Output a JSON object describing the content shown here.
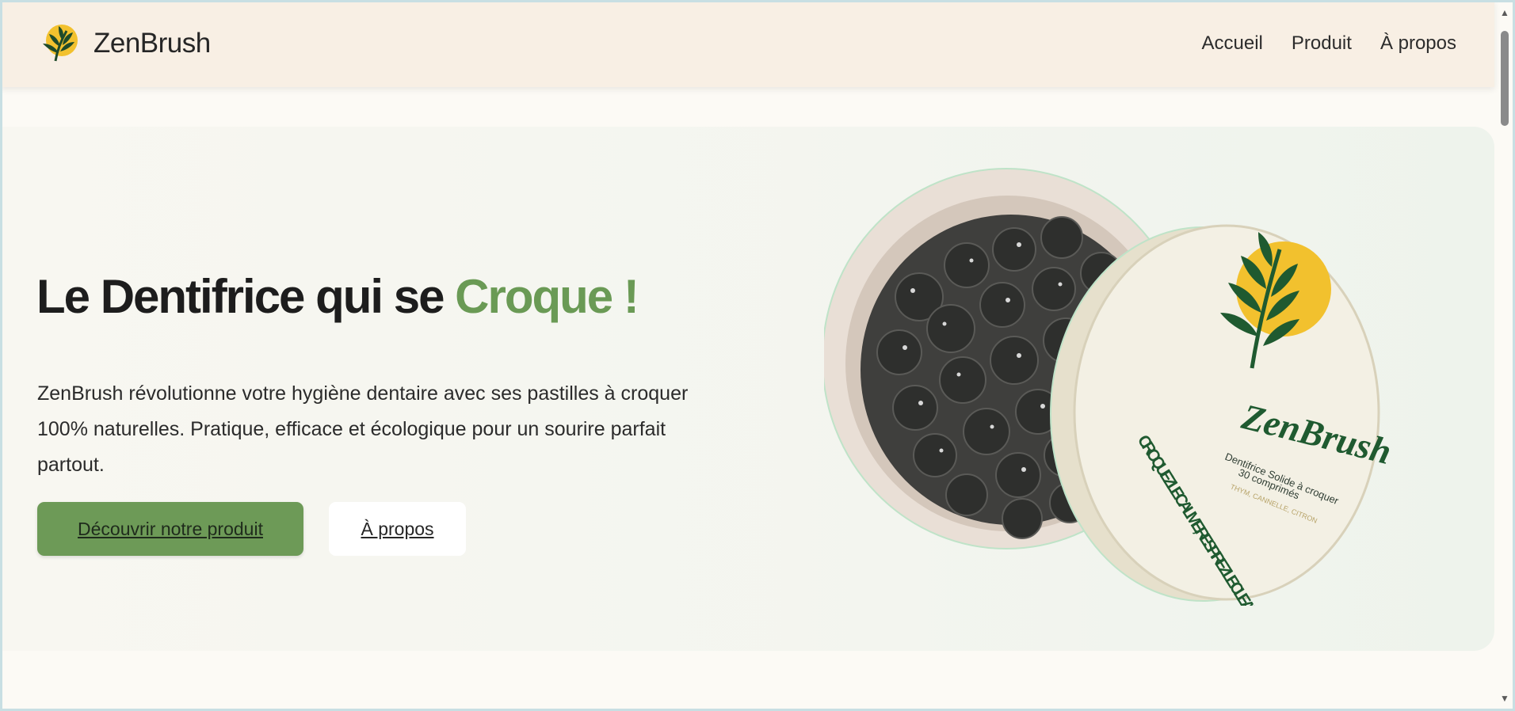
{
  "header": {
    "brand": "ZenBrush",
    "nav": [
      "Accueil",
      "Produit",
      "À propos"
    ]
  },
  "hero": {
    "title_main": "Le Dentifrice qui se ",
    "title_accent": "Croque !",
    "description": "ZenBrush révolutionne votre hygiène dentaire avec ses pastilles à croquer 100% naturelles. Pratique, efficace et écologique pour un sourire parfait partout.",
    "primary_button": "Découvrir notre produit",
    "secondary_button": "À propos"
  },
  "product_image": {
    "brand": "ZenBrush",
    "line1": "Dentifrice Solide à croquer",
    "line2": "30 comprimés",
    "line3": "THYM, CANNELLE, CITRON",
    "slogan": "CROQUEZ LE CALME, RESPIREZ LE CLEAN"
  },
  "colors": {
    "accent": "#6a9a55",
    "header_bg": "#f8efe4",
    "page_bg": "#fcfaf5"
  },
  "icons": {
    "logo": "leaf-sun-icon"
  }
}
